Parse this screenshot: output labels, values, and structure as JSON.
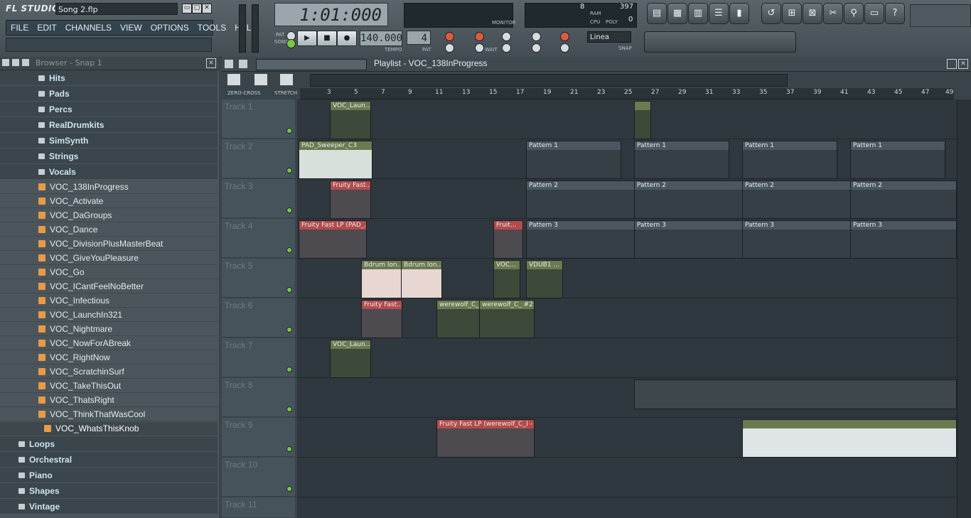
{
  "app": {
    "logo": "FL STUDIO",
    "song_title": "Song 2.flp",
    "window_buttons": [
      "▭",
      "▢",
      "✕"
    ]
  },
  "menu": [
    "FILE",
    "EDIT",
    "CHANNELS",
    "VIEW",
    "OPTIONS",
    "TOOLS",
    "HELP"
  ],
  "transport": {
    "time": "1:01:000",
    "tempo": "140.000",
    "tempo_label": "TEMPO",
    "pattern": "4",
    "pattern_label": "PAT",
    "pat_label": "PAT",
    "song_label": "SONG",
    "monitor_label": "MONITOR",
    "cpu_label": "CPU",
    "poly_label": "POLY",
    "ram_label": "RAM",
    "mem_value": "397",
    "cpu_value": "8",
    "poly_value": "0",
    "snap_value": "Linea",
    "snap_label": "SNAP",
    "wait_label": "WAIT"
  },
  "browser": {
    "title": "Browser - Snap 1",
    "folders_top": [
      "Hits",
      "Pads",
      "Percs",
      "RealDrumkits",
      "SimSynth",
      "Strings",
      "Vocals"
    ],
    "files": [
      "VOC_138InProgress",
      "VOC_Activate",
      "VOC_DaGroups",
      "VOC_Dance",
      "VOC_DivisionPlusMasterBeat",
      "VOC_GiveYouPleasure",
      "VOC_Go",
      "VOC_ICantFeelNoBetter",
      "VOC_Infectious",
      "VOC_LaunchIn321",
      "VOC_Nightmare",
      "VOC_NowForABreak",
      "VOC_RightNow",
      "VOC_ScratchinSurf",
      "VOC_TakeThisOut",
      "VOC_ThatsRight",
      "VOC_ThinkThatWasCool",
      "VOC_WhatsThisKnob"
    ],
    "selected": "VOC_WhatsThisKnob",
    "folders_bottom": [
      "Loops",
      "Orchestral",
      "Piano",
      "Shapes",
      "Vintage"
    ]
  },
  "playlist": {
    "title": "Playlist - VOC_138InProgress",
    "zero_cross": "ZERO-CROSS",
    "stretch": "STRETCH",
    "ruler": [
      "3",
      "5",
      "7",
      "9",
      "11",
      "13",
      "15",
      "17",
      "19",
      "21",
      "23",
      "25",
      "27",
      "29",
      "31",
      "33",
      "35",
      "37",
      "39",
      "41",
      "43",
      "45",
      "47",
      "49"
    ],
    "tracks": [
      "Track 1",
      "Track 2",
      "Track 3",
      "Track 4",
      "Track 5",
      "Track 6",
      "Track 7",
      "Track 8",
      "Track 9",
      "Track 10",
      "Track 11"
    ],
    "clips": {
      "t1a": "VOC_Laun...",
      "t2a": "PAD_Sweeper_C3",
      "p1": "Pattern 1",
      "t3a": "Fruity Fast...",
      "p2": "Pattern 2",
      "t4a": "Fruity Fast LP (PAD_...",
      "t4b": "Fruit...",
      "p3": "Pattern 3",
      "t5a": "Bdrum lon...",
      "t5b": "Bdrum lon...",
      "t5c": "VOC...",
      "t5d": "VDUB1 ...",
      "t6a": "Fruity Fast...",
      "t6b": "werewolf_C_",
      "t6c": "werewolf_C_ #2",
      "t7a": "VOC_Laun...",
      "t9a": "Fruity Fast LP (werewolf_C_) - Cu..."
    }
  }
}
